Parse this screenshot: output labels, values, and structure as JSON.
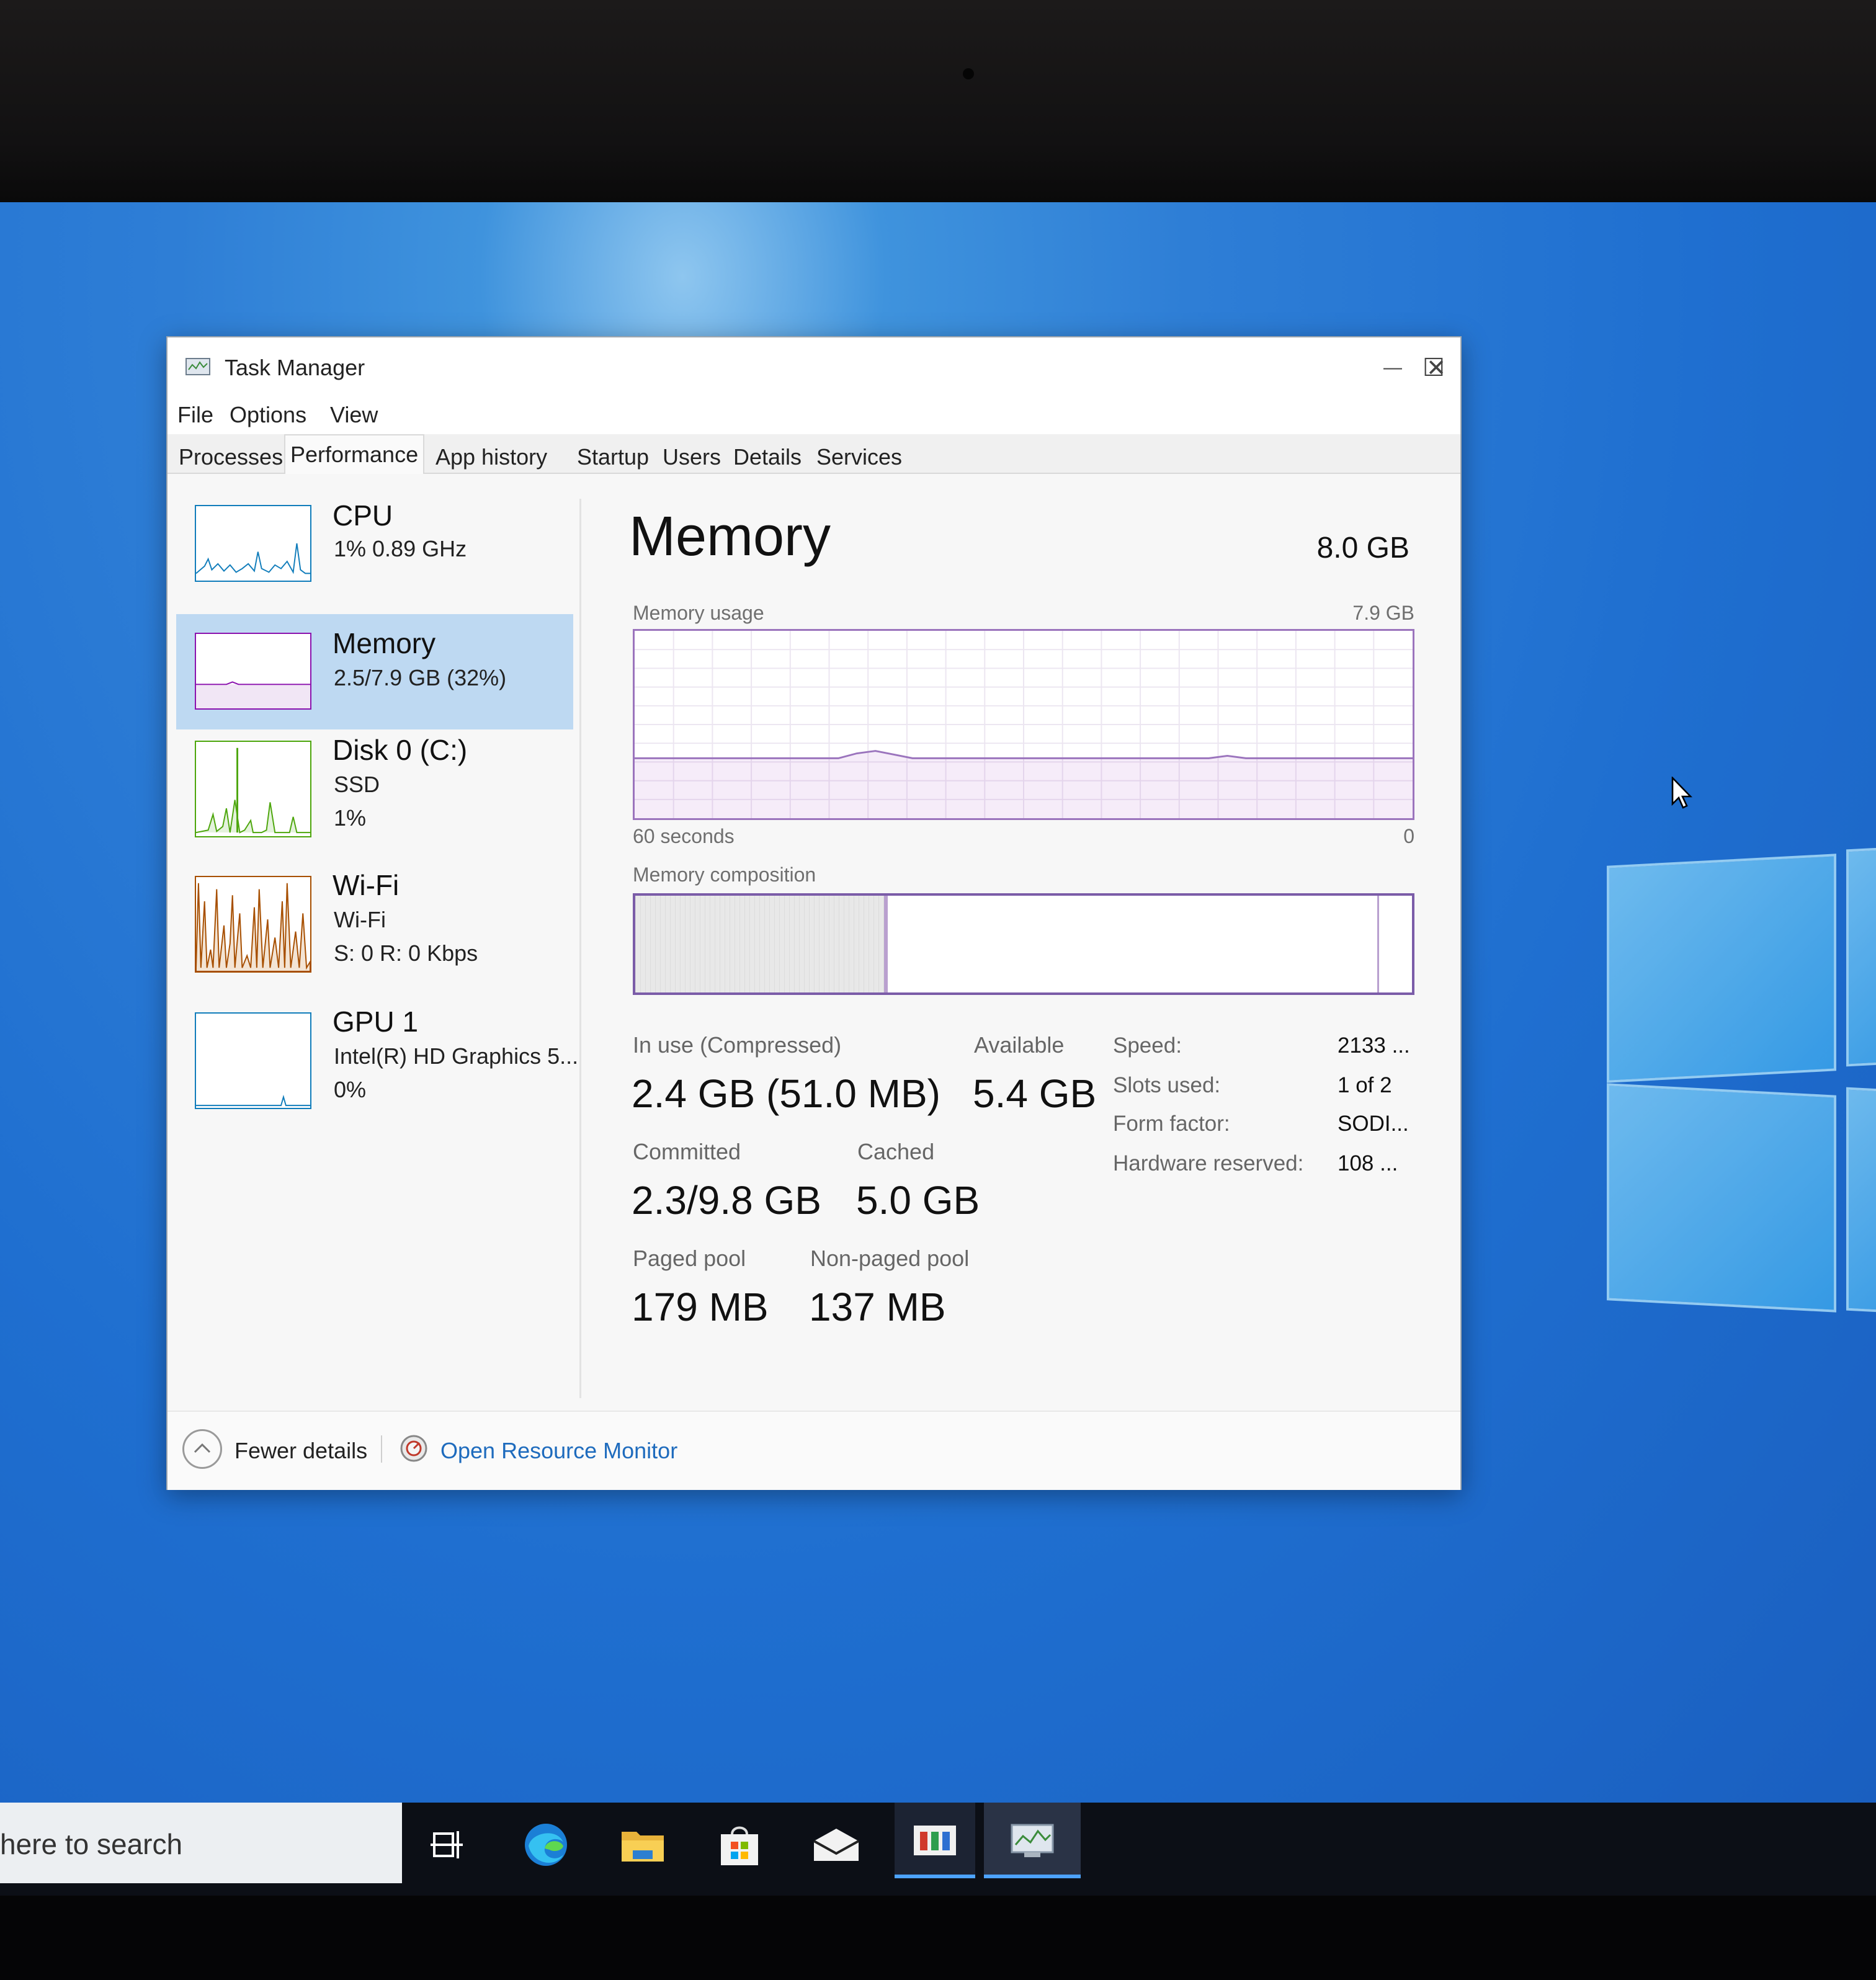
{
  "window": {
    "title": "Task Manager",
    "minimize_glyph": "—",
    "maximize_glyph": "☐",
    "close_glyph": "✕"
  },
  "menu": [
    "File",
    "Options",
    "View"
  ],
  "tabs": [
    "Processes",
    "Performance",
    "App history",
    "Startup",
    "Users",
    "Details",
    "Services"
  ],
  "active_tab": "Performance",
  "sidebar": {
    "items": [
      {
        "title": "CPU",
        "lines": [
          "1%  0.89 GHz"
        ],
        "color": "#117dbb"
      },
      {
        "title": "Memory",
        "lines": [
          "2.5/7.9 GB (32%)"
        ],
        "color": "#8b12ae",
        "selected": true
      },
      {
        "title": "Disk 0 (C:)",
        "lines": [
          "SSD",
          "1%"
        ],
        "color": "#4da60c"
      },
      {
        "title": "Wi-Fi",
        "lines": [
          "Wi-Fi",
          "S: 0  R: 0 Kbps"
        ],
        "color": "#a74f01"
      },
      {
        "title": "GPU 1",
        "lines": [
          "Intel(R) HD Graphics 5...",
          "0%"
        ],
        "color": "#117dbb"
      }
    ]
  },
  "memory": {
    "title": "Memory",
    "total": "8.0 GB",
    "usage_label": "Memory usage",
    "usage_max": "7.9 GB",
    "axis_left": "60 seconds",
    "axis_right": "0",
    "composition_label": "Memory composition",
    "composition": {
      "in_use_fraction": 0.32,
      "modified_fraction": 0.005,
      "standby_fraction": 0.63
    },
    "usage_fraction": 0.32,
    "stats": {
      "in_use_label": "In use (Compressed)",
      "in_use_value": "2.4 GB (51.0 MB)",
      "available_label": "Available",
      "available_value": "5.4 GB",
      "committed_label": "Committed",
      "committed_value": "2.3/9.8 GB",
      "cached_label": "Cached",
      "cached_value": "5.0 GB",
      "paged_label": "Paged pool",
      "paged_value": "179 MB",
      "nonpaged_label": "Non-paged pool",
      "nonpaged_value": "137 MB"
    },
    "specs": [
      {
        "label": "Speed:",
        "value": "2133 ..."
      },
      {
        "label": "Slots used:",
        "value": "1 of 2"
      },
      {
        "label": "Form factor:",
        "value": "SODI..."
      },
      {
        "label": "Hardware reserved:",
        "value": "108 ..."
      }
    ]
  },
  "footer": {
    "fewer_details": "Fewer details",
    "open_resource_monitor": "Open Resource Monitor"
  },
  "taskbar": {
    "search_text": "here to search",
    "icons": [
      "task-view-icon",
      "edge-icon",
      "file-explorer-icon",
      "store-icon",
      "mail-icon",
      "app-icon",
      "task-manager-icon"
    ]
  }
}
